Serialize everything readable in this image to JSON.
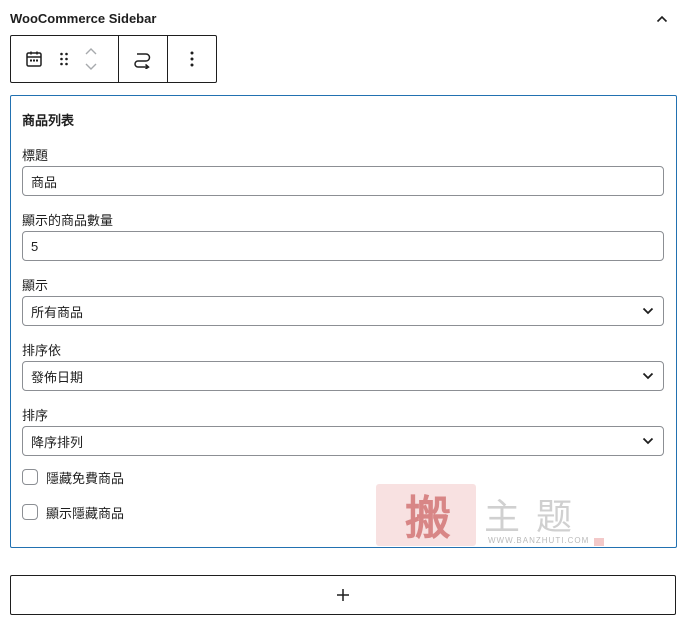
{
  "panel": {
    "title": "WooCommerce Sidebar",
    "collapse_icon": "chevron-up-icon"
  },
  "toolbar": {
    "block_type_icon": "calendar-icon",
    "drag_icon": "drag-handle-icon",
    "move_up_icon": "chevron-up-icon",
    "move_down_icon": "chevron-down-icon",
    "transform_icon": "transform-loop-icon",
    "more_icon": "more-vertical-icon"
  },
  "block": {
    "title": "商品列表",
    "fields": {
      "title": {
        "label": "標題",
        "value": "商品"
      },
      "count": {
        "label": "顯示的商品數量",
        "value": "5"
      },
      "show": {
        "label": "顯示",
        "selected": "所有商品"
      },
      "orderby": {
        "label": "排序依",
        "selected": "發佈日期"
      },
      "order": {
        "label": "排序",
        "selected": "降序排列"
      }
    },
    "checkboxes": [
      {
        "label": "隱藏免費商品",
        "checked": false
      },
      {
        "label": "顯示隱藏商品",
        "checked": false
      }
    ]
  },
  "watermark": {
    "stamp_text": "搬",
    "text": "主题",
    "url": "WWW.BANZHUTI.COM"
  },
  "add_block": {
    "icon": "plus-icon"
  },
  "colors": {
    "accent": "#2271b1",
    "border": "#1e1e1e",
    "input_border": "#8c8f94"
  }
}
